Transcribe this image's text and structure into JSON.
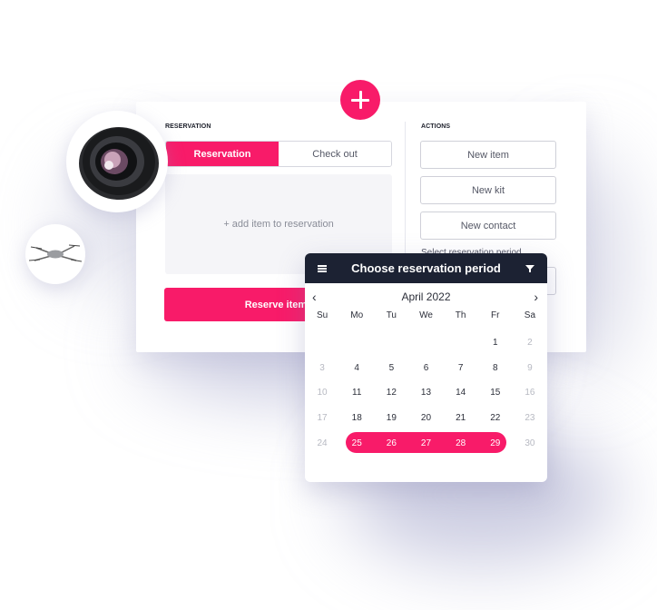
{
  "colors": {
    "accent": "#f81b69",
    "header_dark": "#1c2233",
    "muted_text": "#b7b9c2"
  },
  "reservation": {
    "section_label": "RESERVATION",
    "tabs": [
      {
        "label": "Reservation",
        "active": true
      },
      {
        "label": "Check out",
        "active": false
      }
    ],
    "dropzone_text": "+ add item to reservation",
    "reserve_button": "Reserve items"
  },
  "actions": {
    "section_label": "ACTIONS",
    "buttons": [
      "New item",
      "New kit",
      "New contact"
    ],
    "period_hint": "Select reservation period"
  },
  "fab": {
    "icon": "plus-icon"
  },
  "images": {
    "lens": "camera-lens-image",
    "drone": "drone-image"
  },
  "calendar": {
    "title": "Choose reservation period",
    "menu_icon": "hamburger-menu-icon",
    "filter_icon": "filter-icon",
    "month_label": "April 2022",
    "prev_icon": "chevron-left-icon",
    "next_icon": "chevron-right-icon",
    "weekdays": [
      "Su",
      "Mo",
      "Tu",
      "We",
      "Th",
      "Fr",
      "Sa"
    ],
    "weeks": [
      [
        "",
        "",
        "",
        "",
        "",
        "1",
        "2"
      ],
      [
        "3",
        "4",
        "5",
        "6",
        "7",
        "8",
        "9"
      ],
      [
        "10",
        "11",
        "12",
        "13",
        "14",
        "15",
        "16"
      ],
      [
        "17",
        "18",
        "19",
        "20",
        "21",
        "22",
        "23"
      ],
      [
        "24",
        "25",
        "26",
        "27",
        "28",
        "29",
        "30"
      ]
    ],
    "selected_range": {
      "start": "25",
      "end": "29"
    }
  }
}
